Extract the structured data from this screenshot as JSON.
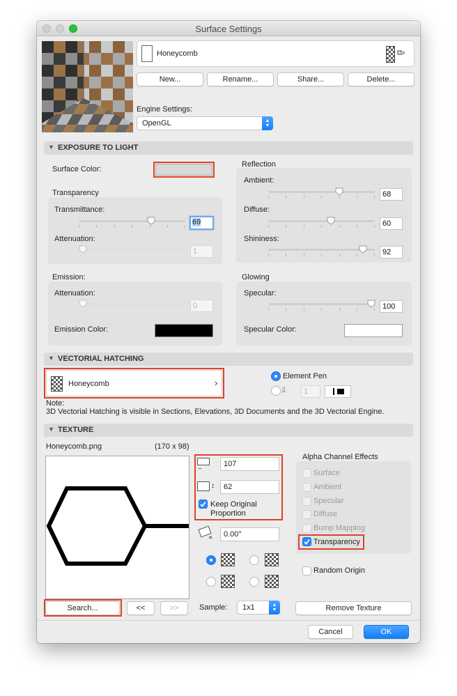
{
  "window": {
    "title": "Surface Settings"
  },
  "header": {
    "surface_name": "Honeycomb",
    "buttons": {
      "new": "New...",
      "rename": "Rename...",
      "share": "Share...",
      "delete": "Delete..."
    },
    "engine_settings_label": "Engine Settings:",
    "engine_value": "OpenGL"
  },
  "exposure": {
    "section_title": "EXPOSURE TO LIGHT",
    "surface_color_label": "Surface Color:",
    "surface_color": "#d8d8d8",
    "transparency": {
      "title": "Transparency",
      "transmittance_label": "Transmittance:",
      "transmittance_value": "69",
      "attenuation_label": "Attenuation:",
      "attenuation_value": "1"
    },
    "reflection": {
      "title": "Reflection",
      "ambient_label": "Ambient:",
      "ambient_value": "68",
      "diffuse_label": "Diffuse:",
      "diffuse_value": "60",
      "shininess_label": "Shininess:",
      "shininess_value": "92"
    },
    "emission": {
      "title": "Emission:",
      "attenuation_label": "Attenuation:",
      "attenuation_value": "0",
      "color_label": "Emission Color:",
      "color": "#000000"
    },
    "glowing": {
      "title": "Glowing",
      "specular_label": "Specular:",
      "specular_value": "100",
      "color_label": "Specular Color:",
      "color": "#ffffff"
    }
  },
  "hatching": {
    "section_title": "VECTORIAL HATCHING",
    "fill_name": "Honeycomb",
    "element_pen_label": "Element Pen",
    "pen_number": "1",
    "note_title": "Note:",
    "note_text": "3D Vectorial Hatching is visible in Sections, Elevations, 3D Documents and the 3D Vectorial Engine."
  },
  "texture": {
    "section_title": "TEXTURE",
    "file_name": "Honeycomb.png",
    "dimensions": "(170 x 98)",
    "width_value": "107",
    "height_value": "62",
    "keep_proportion_label": "Keep Original Proportion",
    "angle_value": "0.00°",
    "alpha_title": "Alpha Channel Effects",
    "alpha_effects": [
      {
        "label": "Surface",
        "checked": false,
        "enabled": false
      },
      {
        "label": "Ambient",
        "checked": false,
        "enabled": false
      },
      {
        "label": "Specular",
        "checked": false,
        "enabled": false
      },
      {
        "label": "Diffuse",
        "checked": false,
        "enabled": false
      },
      {
        "label": "Bump Mapping",
        "checked": false,
        "enabled": false
      },
      {
        "label": "Transparency",
        "checked": true,
        "enabled": true
      }
    ],
    "random_origin_label": "Random Origin",
    "search_button": "Search...",
    "prev_button": "<<",
    "next_button": ">>",
    "sample_label": "Sample:",
    "sample_value": "1x1",
    "remove_button": "Remove Texture"
  },
  "footer": {
    "cancel": "Cancel",
    "ok": "OK"
  }
}
